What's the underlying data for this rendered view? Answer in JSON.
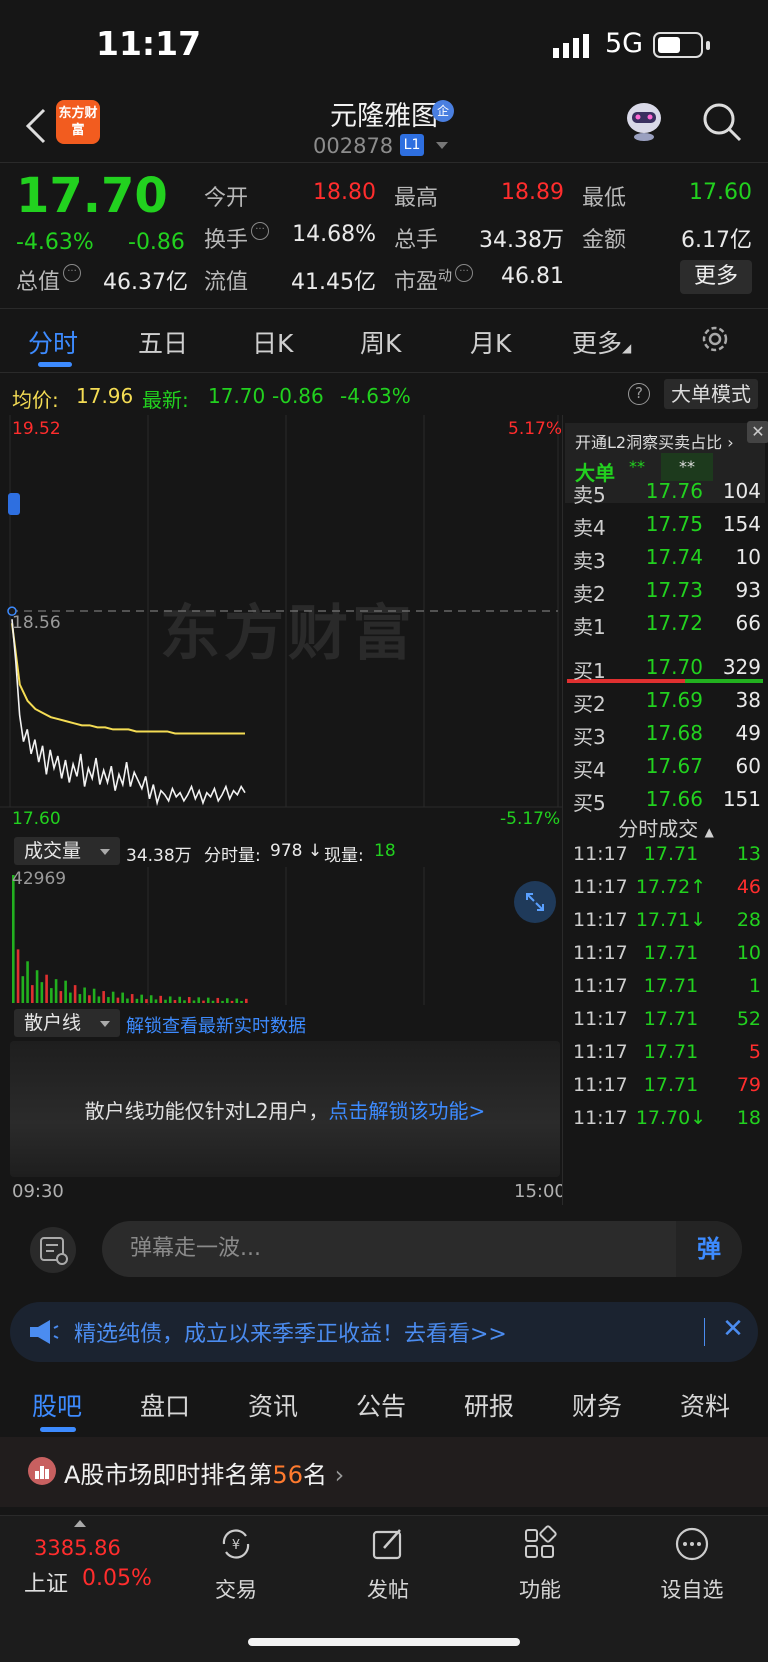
{
  "status": {
    "time": "11:17",
    "network": "5G"
  },
  "header": {
    "logo_text": "东方财富",
    "stock_name": "元隆雅图",
    "verified_badge": "企",
    "stock_code": "002878",
    "level_badge": "L1"
  },
  "quote": {
    "price": "17.70",
    "change_pct": "-4.63%",
    "change": "-0.86",
    "open_label": "今开",
    "open": "18.80",
    "high_label": "最高",
    "high": "18.89",
    "low_label": "最低",
    "low": "17.60",
    "turnover_label": "换手",
    "turnover": "14.68%",
    "volume_label": "总手",
    "volume": "34.38万",
    "amount_label": "金额",
    "amount": "6.17亿",
    "mktcap_label": "总值",
    "mktcap": "46.37亿",
    "float_label": "流值",
    "float_cap": "41.45亿",
    "pe_label": "市盈",
    "pe_sup": "动",
    "pe": "46.81",
    "more_label": "更多"
  },
  "chart_tabs": [
    "分时",
    "五日",
    "日K",
    "周K",
    "月K",
    "更多"
  ],
  "info_bar": {
    "avg_label": "均价:",
    "avg": "17.96",
    "latest_label": "最新:",
    "latest": "17.70",
    "latest_chg": "-0.86",
    "latest_pct": "-4.63%",
    "big_order_mode": "大单模式"
  },
  "chart_data": {
    "type": "line",
    "y_left_labels": [
      "19.52",
      "18.56",
      "17.60"
    ],
    "y_right_labels": [
      "5.17%",
      "-5.17%"
    ],
    "ylim": [
      17.6,
      19.52
    ],
    "prev_close": 18.56,
    "watermark": "东方财富",
    "x_labels": [
      "09:30",
      "15:00"
    ],
    "series": [
      {
        "values": [
          18.52,
          18.31,
          18.05,
          17.92,
          17.98,
          17.86,
          17.93,
          17.82,
          17.9,
          17.76,
          17.88,
          17.79,
          17.85,
          17.74,
          17.83,
          17.72,
          17.81,
          17.75,
          17.86,
          17.7,
          17.79,
          17.74,
          17.84,
          17.71,
          17.78,
          17.72,
          17.8,
          17.68,
          17.76,
          17.71,
          17.82,
          17.7,
          17.77,
          17.73,
          17.69,
          17.75,
          17.64,
          17.71,
          17.62,
          17.68,
          17.66,
          17.63,
          17.69,
          17.65,
          17.67,
          17.63,
          17.66,
          17.7,
          17.64,
          17.68,
          17.62,
          17.67,
          17.65,
          17.69,
          17.63,
          17.66,
          17.7,
          17.64,
          17.68,
          17.66,
          17.7,
          17.67
        ]
      },
      {
        "values": [
          18.5,
          18.2,
          18.12,
          18.08,
          18.06,
          18.04,
          18.03,
          18.02,
          18.01,
          18.0,
          18.0,
          17.99,
          17.99,
          17.98,
          17.98,
          17.98,
          17.97,
          17.97,
          17.97,
          17.97,
          17.97,
          17.96,
          17.96,
          17.96,
          17.96,
          17.96,
          17.96,
          17.96,
          17.96,
          17.96,
          17.96
        ]
      }
    ]
  },
  "volume": {
    "label": "成交量",
    "total": "34.38万",
    "minute_label": "分时量:",
    "minute_value": "978",
    "current_label": "现量:",
    "current_value": "18",
    "max_label": "42969",
    "bars": [
      42969,
      18000,
      9000,
      14000,
      6000,
      11000,
      7000,
      9500,
      5000,
      8000,
      4000,
      7500,
      3500,
      6000,
      3000,
      5200,
      2600,
      4800,
      2200,
      4000,
      2000,
      3800,
      1800,
      3500,
      1500,
      3000,
      1400,
      2800,
      1300,
      2600,
      1200,
      2400,
      1100,
      2200,
      1000,
      2100,
      900,
      2000,
      850,
      1900,
      800,
      1800,
      750,
      1700,
      700,
      1600,
      700,
      1500,
      650,
      1400
    ]
  },
  "retail": {
    "label": "散户线",
    "unlock_link": "解锁查看最新实时数据",
    "message": "散户线功能仅针对L2用户，",
    "message_link": "点击解锁该功能>"
  },
  "order_book": {
    "promo_title": "开通L2洞察买卖占比",
    "promo_label": "大单",
    "promo_v1": "**",
    "promo_v2": "**",
    "asks": [
      {
        "label": "卖5",
        "price": "17.76",
        "qty": "104"
      },
      {
        "label": "卖4",
        "price": "17.75",
        "qty": "154"
      },
      {
        "label": "卖3",
        "price": "17.74",
        "qty": "10"
      },
      {
        "label": "卖2",
        "price": "17.73",
        "qty": "93"
      },
      {
        "label": "卖1",
        "price": "17.72",
        "qty": "66"
      }
    ],
    "bids": [
      {
        "label": "买1",
        "price": "17.70",
        "qty": "329"
      },
      {
        "label": "买2",
        "price": "17.69",
        "qty": "38"
      },
      {
        "label": "买3",
        "price": "17.68",
        "qty": "49"
      },
      {
        "label": "买4",
        "price": "17.67",
        "qty": "60"
      },
      {
        "label": "买5",
        "price": "17.66",
        "qty": "151"
      }
    ],
    "trades_title": "分时成交",
    "trades": [
      {
        "time": "11:17",
        "price": "17.71",
        "vol": "13",
        "color": "green"
      },
      {
        "time": "11:17",
        "price": "17.72↑",
        "vol": "46",
        "color": "red"
      },
      {
        "time": "11:17",
        "price": "17.71↓",
        "vol": "28",
        "color": "green"
      },
      {
        "time": "11:17",
        "price": "17.71",
        "vol": "10",
        "color": "green"
      },
      {
        "time": "11:17",
        "price": "17.71",
        "vol": "1",
        "color": "green"
      },
      {
        "time": "11:17",
        "price": "17.71",
        "vol": "52",
        "color": "green"
      },
      {
        "time": "11:17",
        "price": "17.71",
        "vol": "5",
        "color": "red"
      },
      {
        "time": "11:17",
        "price": "17.71",
        "vol": "79",
        "color": "red"
      },
      {
        "time": "11:17",
        "price": "17.70↓",
        "vol": "18",
        "color": "green"
      }
    ]
  },
  "comment": {
    "placeholder": "弹幕走一波...",
    "send": "弹"
  },
  "ad": {
    "text": "精选纯债，成立以来季季正收益！去看看>>"
  },
  "sub_tabs": [
    "股吧",
    "盘口",
    "资讯",
    "公告",
    "研报",
    "财务",
    "资料"
  ],
  "rank": {
    "prefix": "A股市场即时排名第",
    "number": "56",
    "suffix": "名"
  },
  "bottom_nav": {
    "index_value": "3385.86",
    "index_name": "上证",
    "index_pct": "0.05%",
    "items": [
      "交易",
      "发帖",
      "功能",
      "设自选"
    ]
  }
}
